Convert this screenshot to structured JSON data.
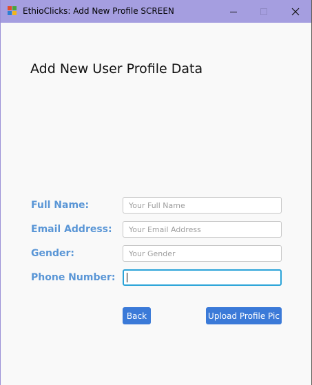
{
  "window": {
    "title": "EthioClicks: Add New Profile SCREEN",
    "title_bar_color": "#a59ee0",
    "controls": [
      "minimize-icon",
      "maximize-icon",
      "close-icon"
    ]
  },
  "form": {
    "heading": "Add New User Profile Data",
    "label_color": "#5a96d6",
    "fields": [
      {
        "label": "Full Name:",
        "placeholder": "Your Full Name",
        "value": ""
      },
      {
        "label": "Email Address:",
        "placeholder": "Your Email Address",
        "value": ""
      },
      {
        "label": "Gender:",
        "placeholder": "Your Gender",
        "value": ""
      },
      {
        "label": "Phone Number:",
        "placeholder": "",
        "value": "",
        "focused": true
      }
    ],
    "back_label": "Back",
    "upload_label": "Upload Profile Pic",
    "button_color": "#3b7ad8"
  }
}
